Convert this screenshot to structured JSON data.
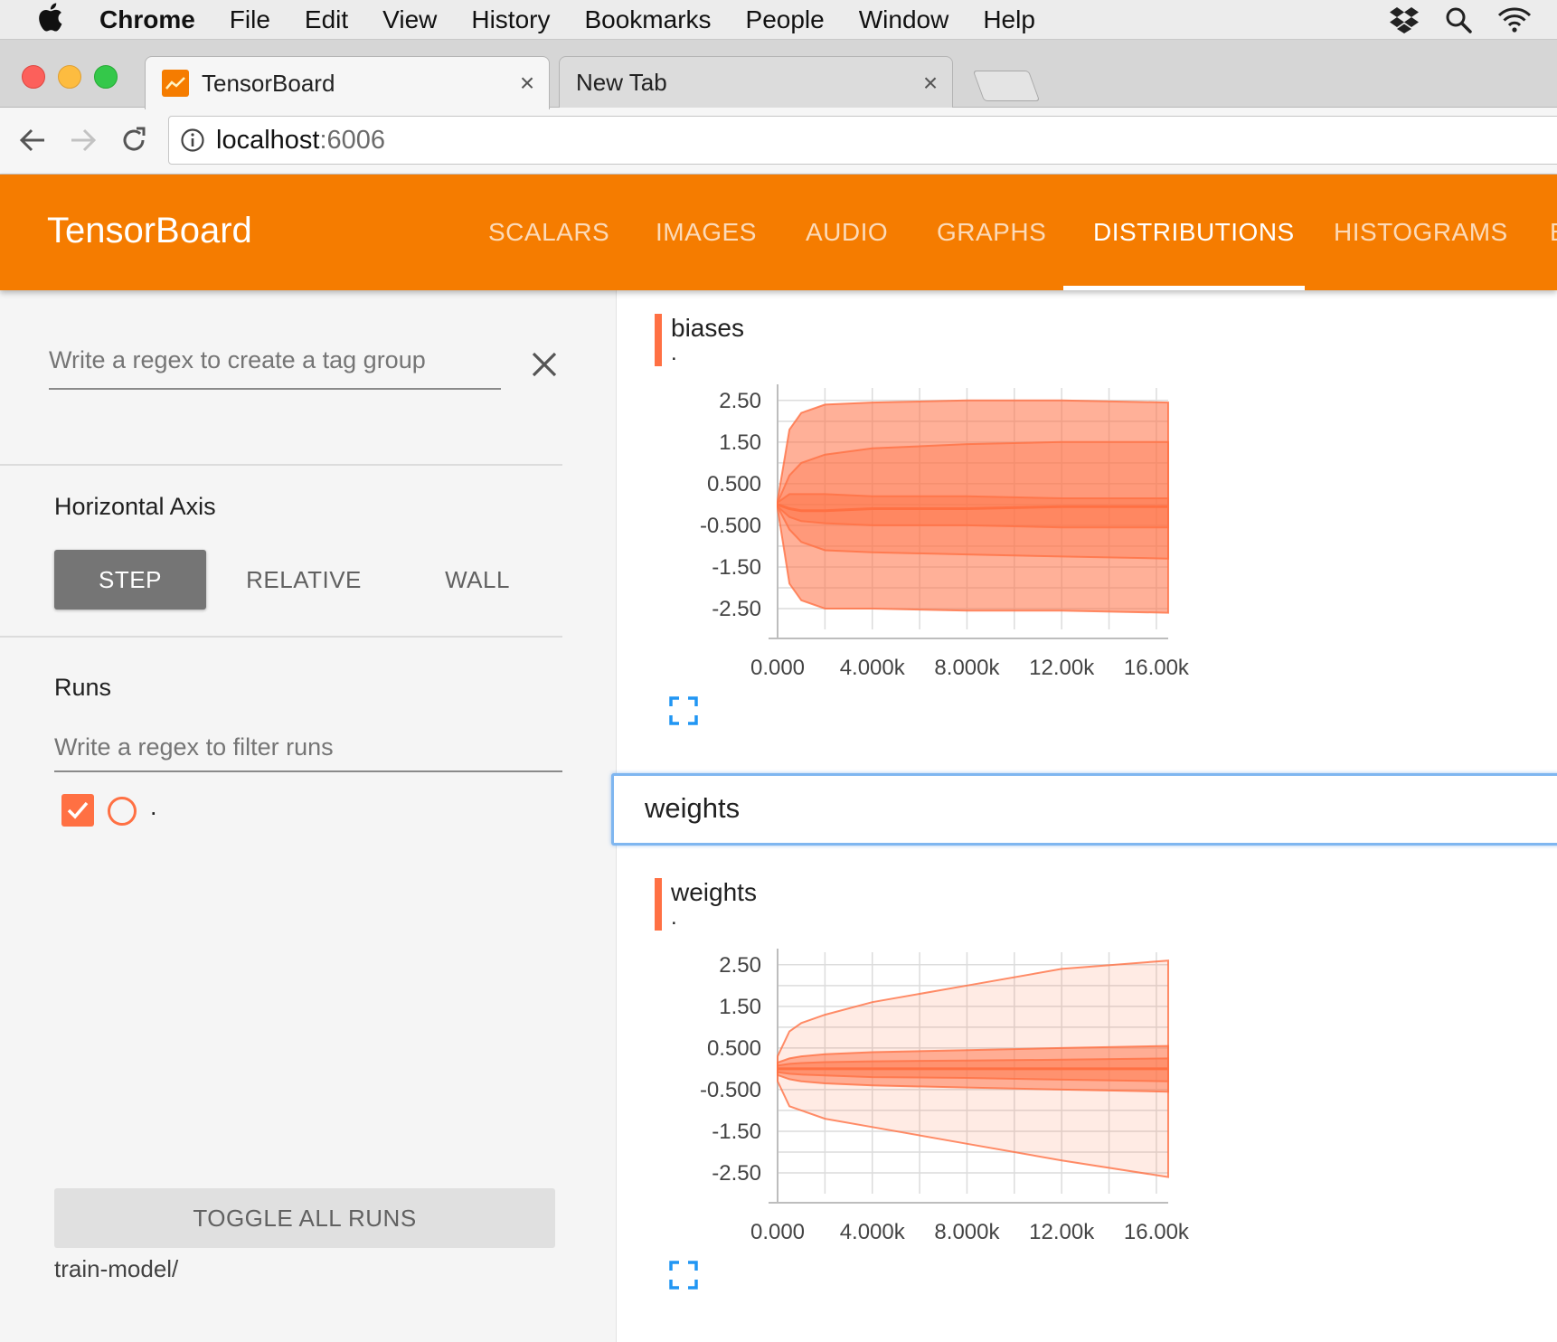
{
  "menubar": {
    "app": "Chrome",
    "items": [
      "File",
      "Edit",
      "View",
      "History",
      "Bookmarks",
      "People",
      "Window",
      "Help"
    ],
    "tray_icons": [
      "dropbox-icon",
      "spotlight-icon",
      "wifi-icon"
    ]
  },
  "browser": {
    "tabs": [
      {
        "title": "TensorBoard",
        "active": true
      },
      {
        "title": "New Tab",
        "active": false
      }
    ],
    "address": {
      "host": "localhost",
      "port": ":6006"
    }
  },
  "tensorboard": {
    "brand": "TensorBoard",
    "nav": [
      "SCALARS",
      "IMAGES",
      "AUDIO",
      "GRAPHS",
      "DISTRIBUTIONS",
      "HISTOGRAMS",
      "E"
    ],
    "active_nav": "DISTRIBUTIONS",
    "accent_color": "#f57c00"
  },
  "sidebar": {
    "tag_group_placeholder": "Write a regex to create a tag group",
    "horizontal_axis": {
      "heading": "Horizontal Axis",
      "options": [
        "STEP",
        "RELATIVE",
        "WALL"
      ],
      "selected": "STEP"
    },
    "runs": {
      "heading": "Runs",
      "filter_placeholder": "Write a regex to filter runs",
      "items": [
        {
          "label": ".",
          "checked": true,
          "color": "#ff7043"
        }
      ],
      "toggle_label": "TOGGLE ALL RUNS",
      "logdir": "train-model/"
    }
  },
  "main": {
    "cards": [
      {
        "title": "biases",
        "run": "."
      },
      {
        "title": "weights",
        "run": "."
      }
    ],
    "group_header": "weights",
    "series_color": "#ff7043"
  },
  "chart_data": [
    {
      "type": "area",
      "title": "biases",
      "x_ticks": [
        "0.000",
        "4.000k",
        "8.000k",
        "12.00k",
        "16.00k"
      ],
      "y_ticks": [
        "2.50",
        "1.50",
        "0.500",
        "-0.500",
        "-1.50",
        "-2.50"
      ],
      "xlim": [
        0,
        16500
      ],
      "ylim": [
        -3,
        2.8
      ],
      "x": [
        0,
        500,
        1000,
        2000,
        4000,
        8000,
        12000,
        16500
      ],
      "bands": [
        {
          "name": "outer",
          "lower": [
            -0.1,
            -1.9,
            -2.3,
            -2.5,
            -2.5,
            -2.55,
            -2.55,
            -2.6
          ],
          "upper": [
            0.1,
            1.8,
            2.2,
            2.4,
            2.45,
            2.5,
            2.5,
            2.45
          ]
        },
        {
          "name": "mid",
          "lower": [
            -0.05,
            -0.6,
            -0.9,
            -1.1,
            -1.15,
            -1.2,
            -1.25,
            -1.3
          ],
          "upper": [
            0.05,
            0.7,
            1.0,
            1.2,
            1.35,
            1.45,
            1.5,
            1.5
          ]
        },
        {
          "name": "inner",
          "lower": [
            -0.05,
            -0.3,
            -0.4,
            -0.45,
            -0.5,
            -0.5,
            -0.55,
            -0.55
          ],
          "upper": [
            0.05,
            0.25,
            0.25,
            0.25,
            0.2,
            0.2,
            0.15,
            0.15
          ]
        }
      ],
      "median": [
        0,
        -0.1,
        -0.15,
        -0.15,
        -0.1,
        -0.1,
        -0.05,
        -0.05
      ]
    },
    {
      "type": "area",
      "title": "weights",
      "x_ticks": [
        "0.000",
        "4.000k",
        "8.000k",
        "12.00k",
        "16.00k"
      ],
      "y_ticks": [
        "2.50",
        "1.50",
        "0.500",
        "-0.500",
        "-1.50",
        "-2.50"
      ],
      "xlim": [
        0,
        16500
      ],
      "ylim": [
        -3,
        2.8
      ],
      "x": [
        0,
        500,
        1000,
        2000,
        4000,
        8000,
        12000,
        16500
      ],
      "bands": [
        {
          "name": "outer",
          "lower": [
            -0.3,
            -0.9,
            -1.0,
            -1.2,
            -1.4,
            -1.8,
            -2.2,
            -2.6
          ],
          "upper": [
            0.3,
            0.9,
            1.1,
            1.3,
            1.6,
            2.0,
            2.4,
            2.6
          ]
        },
        {
          "name": "mid",
          "lower": [
            -0.15,
            -0.25,
            -0.3,
            -0.35,
            -0.4,
            -0.45,
            -0.5,
            -0.55
          ],
          "upper": [
            0.15,
            0.25,
            0.3,
            0.35,
            0.4,
            0.45,
            0.5,
            0.55
          ]
        },
        {
          "name": "inner",
          "lower": [
            -0.08,
            -0.12,
            -0.14,
            -0.16,
            -0.2,
            -0.22,
            -0.26,
            -0.3
          ],
          "upper": [
            0.08,
            0.12,
            0.14,
            0.16,
            0.18,
            0.2,
            0.22,
            0.25
          ]
        }
      ],
      "median": [
        0,
        0,
        0,
        0,
        0,
        0,
        0,
        0
      ]
    }
  ]
}
